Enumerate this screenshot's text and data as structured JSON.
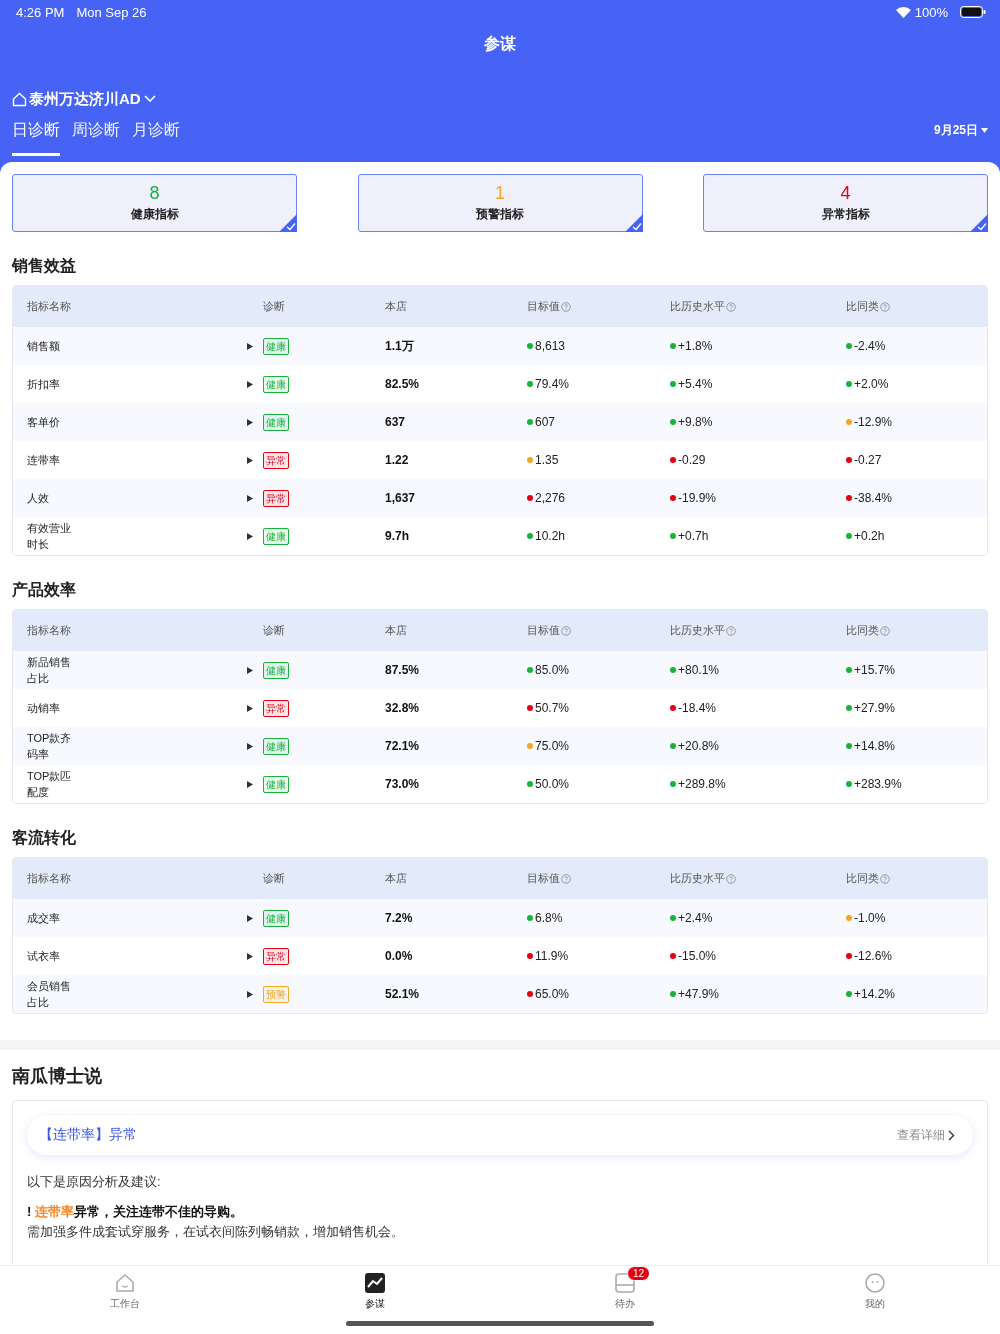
{
  "status_bar": {
    "time": "4:26 PM",
    "date": "Mon Sep 26",
    "battery": "100%"
  },
  "nav_title": "参谋",
  "store": {
    "name": "泰州万达济川AD"
  },
  "tabs": [
    {
      "label": "日诊断",
      "selected": true
    },
    {
      "label": "周诊断",
      "selected": false
    },
    {
      "label": "月诊断",
      "selected": false
    }
  ],
  "date_picker": "9月25日",
  "summary_cards": [
    {
      "count": "8",
      "label": "健康指标",
      "color": "#19b33b",
      "selected": true
    },
    {
      "count": "1",
      "label": "预警指标",
      "color": "#f5a623",
      "selected": true
    },
    {
      "count": "4",
      "label": "异常指标",
      "color": "#e60012",
      "selected": true
    }
  ],
  "sections": [
    {
      "title": "销售效益",
      "columns": [
        {
          "label": "指标名称",
          "help": false
        },
        {
          "label": "诊断",
          "help": false
        },
        {
          "label": "本店",
          "help": false
        },
        {
          "label": "目标值",
          "help": true
        },
        {
          "label": "比历史水平",
          "help": true
        },
        {
          "label": "比同类",
          "help": true
        }
      ],
      "rows": [
        {
          "name": "销售额",
          "diagnosis": {
            "text": "健康",
            "color": "#19b33b"
          },
          "store": "1.1万",
          "target": {
            "text": "8,613",
            "color": "#19b33b"
          },
          "history": {
            "text": "+1.8%",
            "color": "#19b33b"
          },
          "peer": {
            "text": "-2.4%",
            "color": "#19b33b"
          }
        },
        {
          "name": "折扣率",
          "diagnosis": {
            "text": "健康",
            "color": "#19b33b"
          },
          "store": "82.5%",
          "target": {
            "text": "79.4%",
            "color": "#19b33b"
          },
          "history": {
            "text": "+5.4%",
            "color": "#19b33b"
          },
          "peer": {
            "text": "+2.0%",
            "color": "#19b33b"
          }
        },
        {
          "name": "客单价",
          "diagnosis": {
            "text": "健康",
            "color": "#19b33b"
          },
          "store": "637",
          "target": {
            "text": "607",
            "color": "#19b33b"
          },
          "history": {
            "text": "+9.8%",
            "color": "#19b33b"
          },
          "peer": {
            "text": "-12.9%",
            "color": "#f5a623"
          }
        },
        {
          "name": "连带率",
          "diagnosis": {
            "text": "异常",
            "color": "#e60012"
          },
          "store": "1.22",
          "target": {
            "text": "1.35",
            "color": "#f5a623"
          },
          "history": {
            "text": "-0.29",
            "color": "#e60012"
          },
          "peer": {
            "text": "-0.27",
            "color": "#e60012"
          }
        },
        {
          "name": "人效",
          "diagnosis": {
            "text": "异常",
            "color": "#e60012"
          },
          "store": "1,637",
          "target": {
            "text": "2,276",
            "color": "#e60012"
          },
          "history": {
            "text": "-19.9%",
            "color": "#e60012"
          },
          "peer": {
            "text": "-38.4%",
            "color": "#e60012"
          }
        },
        {
          "name": "有效营业时长",
          "diagnosis": {
            "text": "健康",
            "color": "#19b33b"
          },
          "store": "9.7h",
          "target": {
            "text": "10.2h",
            "color": "#19b33b"
          },
          "history": {
            "text": "+0.7h",
            "color": "#19b33b"
          },
          "peer": {
            "text": "+0.2h",
            "color": "#19b33b"
          }
        }
      ]
    },
    {
      "title": "产品效率",
      "columns": [
        {
          "label": "指标名称",
          "help": false
        },
        {
          "label": "诊断",
          "help": false
        },
        {
          "label": "本店",
          "help": false
        },
        {
          "label": "目标值",
          "help": true
        },
        {
          "label": "比历史水平",
          "help": true
        },
        {
          "label": "比同类",
          "help": true
        }
      ],
      "rows": [
        {
          "name": "新品销售占比",
          "diagnosis": {
            "text": "健康",
            "color": "#19b33b"
          },
          "store": "87.5%",
          "target": {
            "text": "85.0%",
            "color": "#19b33b"
          },
          "history": {
            "text": "+80.1%",
            "color": "#19b33b"
          },
          "peer": {
            "text": "+15.7%",
            "color": "#19b33b"
          }
        },
        {
          "name": "动销率",
          "diagnosis": {
            "text": "异常",
            "color": "#e60012"
          },
          "store": "32.8%",
          "target": {
            "text": "50.7%",
            "color": "#e60012"
          },
          "history": {
            "text": "-18.4%",
            "color": "#e60012"
          },
          "peer": {
            "text": "+27.9%",
            "color": "#19b33b"
          }
        },
        {
          "name": "TOP款齐码率",
          "diagnosis": {
            "text": "健康",
            "color": "#19b33b"
          },
          "store": "72.1%",
          "target": {
            "text": "75.0%",
            "color": "#f5a623"
          },
          "history": {
            "text": "+20.8%",
            "color": "#19b33b"
          },
          "peer": {
            "text": "+14.8%",
            "color": "#19b33b"
          }
        },
        {
          "name": "TOP款匹配度",
          "diagnosis": {
            "text": "健康",
            "color": "#19b33b"
          },
          "store": "73.0%",
          "target": {
            "text": "50.0%",
            "color": "#19b33b"
          },
          "history": {
            "text": "+289.8%",
            "color": "#19b33b"
          },
          "peer": {
            "text": "+283.9%",
            "color": "#19b33b"
          }
        }
      ]
    },
    {
      "title": "客流转化",
      "columns": [
        {
          "label": "指标名称",
          "help": false
        },
        {
          "label": "诊断",
          "help": false
        },
        {
          "label": "本店",
          "help": false
        },
        {
          "label": "目标值",
          "help": true
        },
        {
          "label": "比历史水平",
          "help": true
        },
        {
          "label": "比同类",
          "help": true
        }
      ],
      "rows": [
        {
          "name": "成交率",
          "diagnosis": {
            "text": "健康",
            "color": "#19b33b"
          },
          "store": "7.2%",
          "target": {
            "text": "6.8%",
            "color": "#19b33b"
          },
          "history": {
            "text": "+2.4%",
            "color": "#19b33b"
          },
          "peer": {
            "text": "-1.0%",
            "color": "#f5a623"
          }
        },
        {
          "name": "试衣率",
          "diagnosis": {
            "text": "异常",
            "color": "#e60012"
          },
          "store": "0.0%",
          "target": {
            "text": "11.9%",
            "color": "#e60012"
          },
          "history": {
            "text": "-15.0%",
            "color": "#e60012"
          },
          "peer": {
            "text": "-12.6%",
            "color": "#e60012"
          }
        },
        {
          "name": "会员销售占比",
          "diagnosis": {
            "text": "预警",
            "color": "#f5a623"
          },
          "store": "52.1%",
          "target": {
            "text": "65.0%",
            "color": "#e60012"
          },
          "history": {
            "text": "+47.9%",
            "color": "#19b33b"
          },
          "peer": {
            "text": "+14.2%",
            "color": "#19b33b"
          }
        }
      ]
    }
  ],
  "advisor": {
    "title": "南瓜博士说",
    "alert": "【连带率】异常",
    "detail_link": "查看详细",
    "intro": "以下是原因分析及建议:",
    "point": {
      "mark": "!",
      "highlight": "连带率",
      "rest": "异常，关注连带不佳的导购。"
    },
    "advice": "需加强多件成套试穿服务，在试衣间陈列畅销款，增加销售机会。"
  },
  "bottom_nav": [
    {
      "label": "工作台",
      "selected": false
    },
    {
      "label": "参谋",
      "selected": true
    },
    {
      "label": "待办",
      "selected": false,
      "badge": "12"
    },
    {
      "label": "我的",
      "selected": false
    }
  ]
}
